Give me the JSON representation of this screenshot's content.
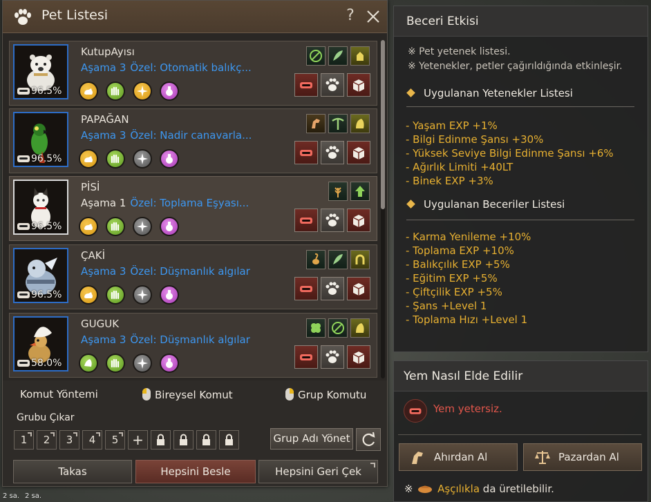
{
  "pet_window": {
    "title": "Pet Listesi",
    "help": "?",
    "pets": [
      {
        "name": "KutupAyısı",
        "stage_label": "Aşama",
        "stage": "3",
        "special": "Özel: Otomatik balıkç...",
        "food": "96.5%",
        "stage_color": "blue",
        "frame": "blue"
      },
      {
        "name": "PAPAĞAN",
        "stage_label": "Aşama",
        "stage": "3",
        "special": "Özel: Nadir canavarla...",
        "food": "96.5%",
        "stage_color": "blue",
        "frame": "blue"
      },
      {
        "name": "PİSİ",
        "stage_label": "Aşama",
        "stage": "1",
        "special": "Özel: Toplama Eşyası...",
        "food": "96.5%",
        "stage_color": "white",
        "frame": "white"
      },
      {
        "name": "ÇAKİ",
        "stage_label": "Aşama",
        "stage": "3",
        "special": "Özel: Düşmanlık algılar",
        "food": "96.5%",
        "stage_color": "blue",
        "frame": "blue"
      },
      {
        "name": "GUGUK",
        "stage_label": "Aşama",
        "stage": "3",
        "special": "Özel: Düşmanlık algılar",
        "food": "58.0%",
        "stage_color": "blue",
        "frame": "blue"
      }
    ],
    "command_method": "Komut Yöntemi",
    "individual_command": "Bireysel Komut",
    "group_command": "Grup Komutu",
    "group_remove": "Grubu Çıkar",
    "slots": [
      "1",
      "2",
      "3",
      "4",
      "5",
      "+"
    ],
    "group_name_button": "Grup Adı Yönet",
    "buttons": {
      "swap": "Takas",
      "feed_all": "Hepsini Besle",
      "recall_all": "Hepsini Geri Çek"
    }
  },
  "effects_panel": {
    "title": "Beceri Etkisi",
    "notes": [
      "※ Pet yetenek listesi.",
      "※ Yetenekler, petler çağırıldığında etkinleşir."
    ],
    "talents_title": "Uygulanan Yetenekler Listesi",
    "talents": [
      "- Yaşam EXP +1%",
      "- Bilgi Edinme Şansı +30%",
      "- Yüksek Seviye Bilgi Edinme Şansı +6%",
      "- Ağırlık Limiti +40LT",
      "- Binek EXP +3%"
    ],
    "skills_title": "Uygulanan Beceriler Listesi",
    "skills": [
      "- Karma Yenileme +10%",
      "- Toplama EXP +10%",
      "- Balıkçılık EXP +5%",
      "- Eğitim EXP +5%",
      "- Çiftçilik EXP +5%",
      "- Şans +Level 1",
      "- Toplama Hızı +Level 1"
    ]
  },
  "food_panel": {
    "title": "Yem Nasıl Elde Edilir",
    "missing": "Yem yetersiz.",
    "stable_button": "Ahırdan Al",
    "market_button": "Pazardan Al",
    "cook_note_prefix": "※",
    "cook_note_gold": "Aşçılıkla",
    "cook_note_rest": "da üretilebilir."
  },
  "background": {
    "label1": "2 sa.",
    "label2": "2 sa."
  },
  "colors": {
    "accent_blue": "#3d97f0",
    "accent_gold": "#e7b031",
    "warning_red": "#e2564b"
  }
}
